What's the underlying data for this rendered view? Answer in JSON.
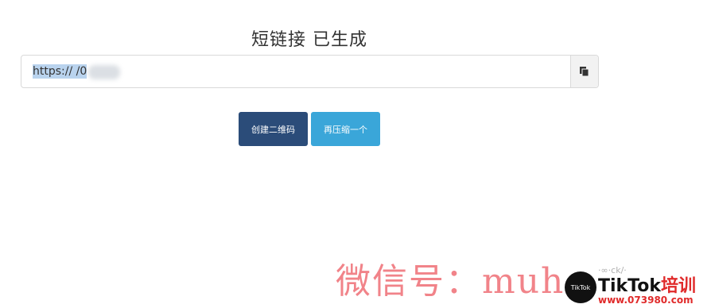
{
  "page": {
    "title": "短链接 已生成"
  },
  "url_field": {
    "value": "https://        /0"
  },
  "buttons": {
    "create_qr": "创建二维码",
    "compress_again": "再压缩一个"
  },
  "icons": {
    "copy": "copy-icon"
  },
  "colors": {
    "primary_dark": "#2b4c79",
    "primary_light": "#3aa6d9",
    "selection": "#b9d3ee"
  },
  "watermark": {
    "text": "微信号：muh",
    "small": "·∞·ck/·"
  },
  "logo": {
    "circle_text": "TikTok",
    "brand_black": "TikTok",
    "brand_red": "培训",
    "site": "www.073980.com"
  }
}
